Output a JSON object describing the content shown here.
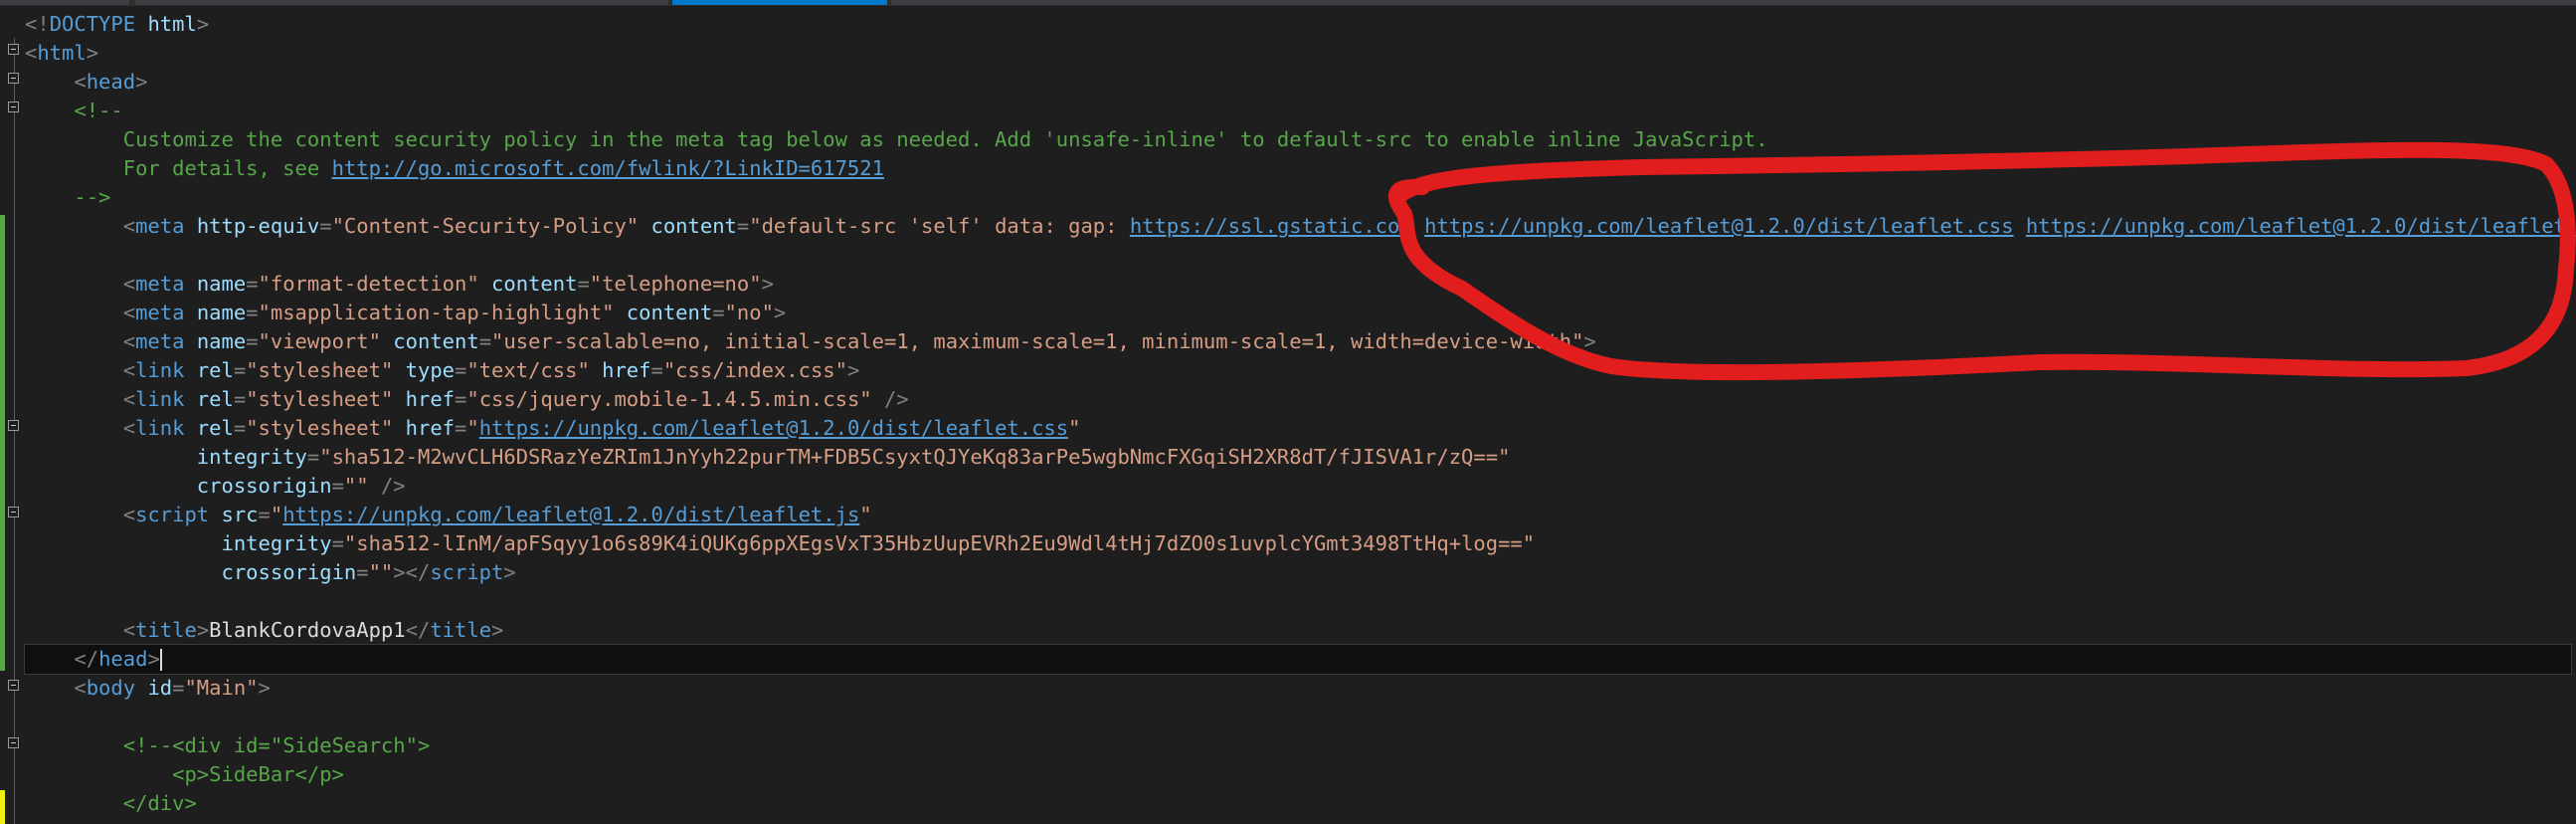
{
  "annotation": {
    "color": "#e11d1d",
    "shape": "hand-drawn-ellipse"
  },
  "colors": {
    "background": "#1e1e1e",
    "tag": "#569cd6",
    "attribute": "#9cdcfe",
    "value": "#d69d85",
    "comment": "#57a64a",
    "link": "#569cd6",
    "delimiter": "#808080"
  },
  "lines": [
    {
      "segs": [
        [
          "b",
          "<!"
        ],
        [
          "t",
          "DOCTYPE"
        ],
        [
          "p",
          " "
        ],
        [
          "a",
          "html"
        ],
        [
          "b",
          ">"
        ]
      ]
    },
    {
      "segs": [
        [
          "b",
          "<"
        ],
        [
          "t",
          "html"
        ],
        [
          "b",
          ">"
        ]
      ]
    },
    {
      "segs": [
        [
          "p",
          "    "
        ],
        [
          "b",
          "<"
        ],
        [
          "t",
          "head"
        ],
        [
          "b",
          ">"
        ]
      ]
    },
    {
      "segs": [
        [
          "p",
          "    "
        ],
        [
          "c",
          "<!--"
        ]
      ]
    },
    {
      "segs": [
        [
          "c",
          "        Customize the content security policy in the meta tag below as needed. Add 'unsafe-inline' to default-src to enable inline JavaScript."
        ]
      ]
    },
    {
      "segs": [
        [
          "c",
          "        For details, see "
        ],
        [
          "u",
          "http://go.microsoft.com/fwlink/?LinkID=617521"
        ]
      ]
    },
    {
      "segs": [
        [
          "p",
          "    "
        ],
        [
          "c",
          "-->"
        ]
      ]
    },
    {
      "segs": [
        [
          "p",
          "        "
        ],
        [
          "b",
          "<"
        ],
        [
          "t",
          "meta"
        ],
        [
          "p",
          " "
        ],
        [
          "a",
          "http-equiv"
        ],
        [
          "b",
          "="
        ],
        [
          "v",
          "\"Content-Security-Policy\""
        ],
        [
          "p",
          " "
        ],
        [
          "a",
          "content"
        ],
        [
          "b",
          "="
        ],
        [
          "v",
          "\"default-src 'self' data: gap: "
        ],
        [
          "u",
          "https://ssl.gstatic.com"
        ],
        [
          "v",
          " "
        ],
        [
          "u",
          "https://unpkg.com/leaflet@1.2.0/dist/leaflet.css"
        ],
        [
          "v",
          " "
        ],
        [
          "u",
          "https://unpkg.com/leaflet@1.2.0/dist/leaflet."
        ]
      ]
    },
    {
      "segs": []
    },
    {
      "segs": [
        [
          "p",
          "        "
        ],
        [
          "b",
          "<"
        ],
        [
          "t",
          "meta"
        ],
        [
          "p",
          " "
        ],
        [
          "a",
          "name"
        ],
        [
          "b",
          "="
        ],
        [
          "v",
          "\"format-detection\""
        ],
        [
          "p",
          " "
        ],
        [
          "a",
          "content"
        ],
        [
          "b",
          "="
        ],
        [
          "v",
          "\"telephone=no\""
        ],
        [
          "b",
          ">"
        ]
      ]
    },
    {
      "segs": [
        [
          "p",
          "        "
        ],
        [
          "b",
          "<"
        ],
        [
          "t",
          "meta"
        ],
        [
          "p",
          " "
        ],
        [
          "a",
          "name"
        ],
        [
          "b",
          "="
        ],
        [
          "v",
          "\"msapplication-tap-highlight\""
        ],
        [
          "p",
          " "
        ],
        [
          "a",
          "content"
        ],
        [
          "b",
          "="
        ],
        [
          "v",
          "\"no\""
        ],
        [
          "b",
          ">"
        ]
      ]
    },
    {
      "segs": [
        [
          "p",
          "        "
        ],
        [
          "b",
          "<"
        ],
        [
          "t",
          "meta"
        ],
        [
          "p",
          " "
        ],
        [
          "a",
          "name"
        ],
        [
          "b",
          "="
        ],
        [
          "v",
          "\"viewport\""
        ],
        [
          "p",
          " "
        ],
        [
          "a",
          "content"
        ],
        [
          "b",
          "="
        ],
        [
          "v",
          "\"user-scalable=no, initial-scale=1, maximum-scale=1, minimum-scale=1, width=device-width\""
        ],
        [
          "b",
          ">"
        ]
      ]
    },
    {
      "segs": [
        [
          "p",
          "        "
        ],
        [
          "b",
          "<"
        ],
        [
          "t",
          "link"
        ],
        [
          "p",
          " "
        ],
        [
          "a",
          "rel"
        ],
        [
          "b",
          "="
        ],
        [
          "v",
          "\"stylesheet\""
        ],
        [
          "p",
          " "
        ],
        [
          "a",
          "type"
        ],
        [
          "b",
          "="
        ],
        [
          "v",
          "\"text/css\""
        ],
        [
          "p",
          " "
        ],
        [
          "a",
          "href"
        ],
        [
          "b",
          "="
        ],
        [
          "v",
          "\"css/index.css\""
        ],
        [
          "b",
          ">"
        ]
      ]
    },
    {
      "segs": [
        [
          "p",
          "        "
        ],
        [
          "b",
          "<"
        ],
        [
          "t",
          "link"
        ],
        [
          "p",
          " "
        ],
        [
          "a",
          "rel"
        ],
        [
          "b",
          "="
        ],
        [
          "v",
          "\"stylesheet\""
        ],
        [
          "p",
          " "
        ],
        [
          "a",
          "href"
        ],
        [
          "b",
          "="
        ],
        [
          "v",
          "\"css/jquery.mobile-1.4.5.min.css\""
        ],
        [
          "p",
          " "
        ],
        [
          "b",
          "/>"
        ]
      ]
    },
    {
      "segs": [
        [
          "p",
          "        "
        ],
        [
          "b",
          "<"
        ],
        [
          "t",
          "link"
        ],
        [
          "p",
          " "
        ],
        [
          "a",
          "rel"
        ],
        [
          "b",
          "="
        ],
        [
          "v",
          "\"stylesheet\""
        ],
        [
          "p",
          " "
        ],
        [
          "a",
          "href"
        ],
        [
          "b",
          "="
        ],
        [
          "v",
          "\""
        ],
        [
          "u",
          "https://unpkg.com/leaflet@1.2.0/dist/leaflet.css"
        ],
        [
          "v",
          "\""
        ]
      ]
    },
    {
      "segs": [
        [
          "p",
          "              "
        ],
        [
          "a",
          "integrity"
        ],
        [
          "b",
          "="
        ],
        [
          "v",
          "\"sha512-M2wvCLH6DSRazYeZRIm1JnYyh22purTM+FDB5CsyxtQJYeKq83arPe5wgbNmcFXGqiSH2XR8dT/fJISVA1r/zQ==\""
        ]
      ]
    },
    {
      "segs": [
        [
          "p",
          "              "
        ],
        [
          "a",
          "crossorigin"
        ],
        [
          "b",
          "="
        ],
        [
          "v",
          "\"\""
        ],
        [
          "p",
          " "
        ],
        [
          "b",
          "/>"
        ]
      ]
    },
    {
      "segs": [
        [
          "p",
          "        "
        ],
        [
          "b",
          "<"
        ],
        [
          "t",
          "script"
        ],
        [
          "p",
          " "
        ],
        [
          "a",
          "src"
        ],
        [
          "b",
          "="
        ],
        [
          "v",
          "\""
        ],
        [
          "u",
          "https://unpkg.com/leaflet@1.2.0/dist/leaflet.js"
        ],
        [
          "v",
          "\""
        ]
      ]
    },
    {
      "segs": [
        [
          "p",
          "                "
        ],
        [
          "a",
          "integrity"
        ],
        [
          "b",
          "="
        ],
        [
          "v",
          "\"sha512-lInM/apFSqyy1o6s89K4iQUKg6ppXEgsVxT35HbzUupEVRh2Eu9Wdl4tHj7dZO0s1uvplcYGmt3498TtHq+log==\""
        ]
      ]
    },
    {
      "segs": [
        [
          "p",
          "                "
        ],
        [
          "a",
          "crossorigin"
        ],
        [
          "b",
          "="
        ],
        [
          "v",
          "\"\""
        ],
        [
          "b",
          "></"
        ],
        [
          "t",
          "script"
        ],
        [
          "b",
          ">"
        ]
      ]
    },
    {
      "segs": []
    },
    {
      "segs": [
        [
          "p",
          "        "
        ],
        [
          "b",
          "<"
        ],
        [
          "t",
          "title"
        ],
        [
          "b",
          ">"
        ],
        [
          "p",
          "BlankCordovaApp1"
        ],
        [
          "b",
          "</"
        ],
        [
          "t",
          "title"
        ],
        [
          "b",
          ">"
        ]
      ]
    },
    {
      "segs": [
        [
          "p",
          "    "
        ],
        [
          "b",
          "</"
        ],
        [
          "t",
          "head"
        ],
        [
          "b",
          ">"
        ]
      ],
      "current": true
    },
    {
      "segs": [
        [
          "p",
          "    "
        ],
        [
          "b",
          "<"
        ],
        [
          "t",
          "body"
        ],
        [
          "p",
          " "
        ],
        [
          "a",
          "id"
        ],
        [
          "b",
          "="
        ],
        [
          "v",
          "\"Main\""
        ],
        [
          "b",
          ">"
        ]
      ]
    },
    {
      "segs": []
    },
    {
      "segs": [
        [
          "p",
          "        "
        ],
        [
          "c",
          "<!--<div id=\"SideSearch\">"
        ]
      ]
    },
    {
      "segs": [
        [
          "c",
          "            <p>SideBar</p>"
        ]
      ]
    },
    {
      "segs": [
        [
          "c",
          "        </div>"
        ]
      ]
    }
  ]
}
